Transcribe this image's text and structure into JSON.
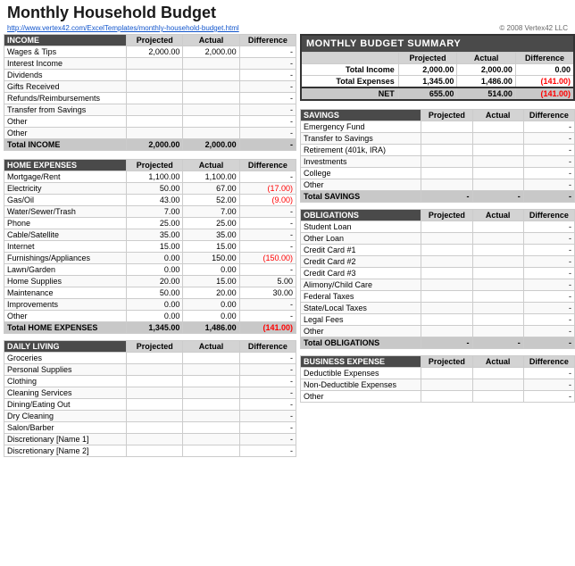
{
  "title": "Monthly Household Budget",
  "link": "http://www.vertex42.com/ExcelTemplates/monthly-household-budget.html",
  "copyright": "© 2008 Vertex42 LLC",
  "summary": {
    "title": "MONTHLY BUDGET SUMMARY",
    "headers": [
      "",
      "Projected",
      "Actual",
      "Difference"
    ],
    "rows": [
      {
        "label": "Total Income",
        "projected": "2,000.00",
        "actual": "2,000.00",
        "difference": "0.00",
        "neg": false
      },
      {
        "label": "Total Expenses",
        "projected": "1,345.00",
        "actual": "1,486.00",
        "difference": "(141.00)",
        "neg": true
      }
    ],
    "net": {
      "label": "NET",
      "projected": "655.00",
      "actual": "514.00",
      "difference": "(141.00)",
      "neg": true
    }
  },
  "income": {
    "title": "INCOME",
    "headers": [
      "",
      "Projected",
      "Actual",
      "Difference"
    ],
    "rows": [
      {
        "label": "Wages & Tips",
        "projected": "2,000.00",
        "actual": "2,000.00",
        "difference": "-"
      },
      {
        "label": "Interest Income",
        "projected": "",
        "actual": "",
        "difference": "-"
      },
      {
        "label": "Dividends",
        "projected": "",
        "actual": "",
        "difference": "-"
      },
      {
        "label": "Gifts Received",
        "projected": "",
        "actual": "",
        "difference": "-"
      },
      {
        "label": "Refunds/Reimbursements",
        "projected": "",
        "actual": "",
        "difference": "-"
      },
      {
        "label": "Transfer from Savings",
        "projected": "",
        "actual": "",
        "difference": "-"
      },
      {
        "label": "Other",
        "projected": "",
        "actual": "",
        "difference": "-"
      },
      {
        "label": "Other",
        "projected": "",
        "actual": "",
        "difference": "-"
      }
    ],
    "total": {
      "label": "Total INCOME",
      "projected": "2,000.00",
      "actual": "2,000.00",
      "difference": "-"
    }
  },
  "home_expenses": {
    "title": "HOME EXPENSES",
    "headers": [
      "",
      "Projected",
      "Actual",
      "Difference"
    ],
    "rows": [
      {
        "label": "Mortgage/Rent",
        "projected": "1,100.00",
        "actual": "1,100.00",
        "difference": "-"
      },
      {
        "label": "Electricity",
        "projected": "50.00",
        "actual": "67.00",
        "difference": "(17.00)",
        "neg": true
      },
      {
        "label": "Gas/Oil",
        "projected": "43.00",
        "actual": "52.00",
        "difference": "(9.00)",
        "neg": true
      },
      {
        "label": "Water/Sewer/Trash",
        "projected": "7.00",
        "actual": "7.00",
        "difference": "-"
      },
      {
        "label": "Phone",
        "projected": "25.00",
        "actual": "25.00",
        "difference": "-"
      },
      {
        "label": "Cable/Satellite",
        "projected": "35.00",
        "actual": "35.00",
        "difference": "-"
      },
      {
        "label": "Internet",
        "projected": "15.00",
        "actual": "15.00",
        "difference": "-"
      },
      {
        "label": "Furnishings/Appliances",
        "projected": "0.00",
        "actual": "150.00",
        "difference": "(150.00)",
        "neg": true
      },
      {
        "label": "Lawn/Garden",
        "projected": "0.00",
        "actual": "0.00",
        "difference": "-"
      },
      {
        "label": "Home Supplies",
        "projected": "20.00",
        "actual": "15.00",
        "difference": "5.00"
      },
      {
        "label": "Maintenance",
        "projected": "50.00",
        "actual": "20.00",
        "difference": "30.00"
      },
      {
        "label": "Improvements",
        "projected": "0.00",
        "actual": "0.00",
        "difference": "-"
      },
      {
        "label": "Other",
        "projected": "0.00",
        "actual": "0.00",
        "difference": "-"
      }
    ],
    "total": {
      "label": "Total HOME EXPENSES",
      "projected": "1,345.00",
      "actual": "1,486.00",
      "difference": "(141.00)",
      "neg": true
    }
  },
  "daily_living": {
    "title": "DAILY LIVING",
    "headers": [
      "",
      "Projected",
      "Actual",
      "Difference"
    ],
    "rows": [
      {
        "label": "Groceries",
        "projected": "",
        "actual": "",
        "difference": "-"
      },
      {
        "label": "Personal Supplies",
        "projected": "",
        "actual": "",
        "difference": "-"
      },
      {
        "label": "Clothing",
        "projected": "",
        "actual": "",
        "difference": "-"
      },
      {
        "label": "Cleaning Services",
        "projected": "",
        "actual": "",
        "difference": "-"
      },
      {
        "label": "Dining/Eating Out",
        "projected": "",
        "actual": "",
        "difference": "-"
      },
      {
        "label": "Dry Cleaning",
        "projected": "",
        "actual": "",
        "difference": "-"
      },
      {
        "label": "Salon/Barber",
        "projected": "",
        "actual": "",
        "difference": "-"
      },
      {
        "label": "Discretionary [Name 1]",
        "projected": "",
        "actual": "",
        "difference": "-"
      },
      {
        "label": "Discretionary [Name 2]",
        "projected": "",
        "actual": "",
        "difference": "-"
      }
    ]
  },
  "savings": {
    "title": "SAVINGS",
    "headers": [
      "",
      "Projected",
      "Actual",
      "Difference"
    ],
    "rows": [
      {
        "label": "Emergency Fund",
        "projected": "",
        "actual": "",
        "difference": "-"
      },
      {
        "label": "Transfer to Savings",
        "projected": "",
        "actual": "",
        "difference": "-"
      },
      {
        "label": "Retirement (401k, IRA)",
        "projected": "",
        "actual": "",
        "difference": "-"
      },
      {
        "label": "Investments",
        "projected": "",
        "actual": "",
        "difference": "-"
      },
      {
        "label": "College",
        "projected": "",
        "actual": "",
        "difference": "-"
      },
      {
        "label": "Other",
        "projected": "",
        "actual": "",
        "difference": "-"
      }
    ],
    "total": {
      "label": "Total SAVINGS",
      "projected": "-",
      "actual": "-",
      "difference": "-"
    }
  },
  "obligations": {
    "title": "OBLIGATIONS",
    "headers": [
      "",
      "Projected",
      "Actual",
      "Difference"
    ],
    "rows": [
      {
        "label": "Student Loan",
        "projected": "",
        "actual": "",
        "difference": "-"
      },
      {
        "label": "Other Loan",
        "projected": "",
        "actual": "",
        "difference": "-"
      },
      {
        "label": "Credit Card #1",
        "projected": "",
        "actual": "",
        "difference": "-"
      },
      {
        "label": "Credit Card #2",
        "projected": "",
        "actual": "",
        "difference": "-"
      },
      {
        "label": "Credit Card #3",
        "projected": "",
        "actual": "",
        "difference": "-"
      },
      {
        "label": "Alimony/Child Care",
        "projected": "",
        "actual": "",
        "difference": "-"
      },
      {
        "label": "Federal Taxes",
        "projected": "",
        "actual": "",
        "difference": "-"
      },
      {
        "label": "State/Local Taxes",
        "projected": "",
        "actual": "",
        "difference": "-"
      },
      {
        "label": "Legal Fees",
        "projected": "",
        "actual": "",
        "difference": "-"
      },
      {
        "label": "Other",
        "projected": "",
        "actual": "",
        "difference": "-"
      }
    ],
    "total": {
      "label": "Total OBLIGATIONS",
      "projected": "-",
      "actual": "-",
      "difference": "-"
    }
  },
  "business": {
    "title": "BUSINESS EXPENSE",
    "headers": [
      "",
      "Projected",
      "Actual",
      "Difference"
    ],
    "rows": [
      {
        "label": "Deductible Expenses",
        "projected": "",
        "actual": "",
        "difference": "-"
      },
      {
        "label": "Non-Deductible Expenses",
        "projected": "",
        "actual": "",
        "difference": "-"
      },
      {
        "label": "Other",
        "projected": "",
        "actual": "",
        "difference": "-"
      }
    ]
  }
}
